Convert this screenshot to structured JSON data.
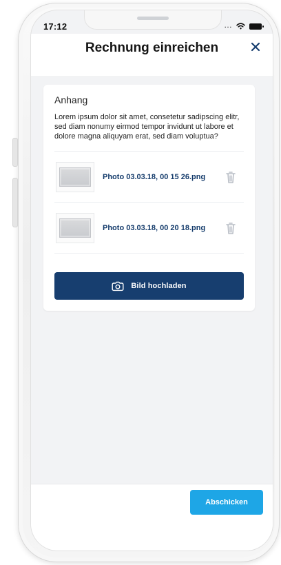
{
  "status_bar": {
    "time": "17:12",
    "signal_icon": "signal-dots-icon",
    "wifi_icon": "wifi-icon",
    "battery_icon": "battery-icon"
  },
  "header": {
    "title": "Rechnung einreichen",
    "close_icon": "close-icon"
  },
  "attachment_section": {
    "heading": "Anhang",
    "description": "Lorem ipsum dolor sit amet, consetetur sadipscing elitr, sed diam nonumy eirmod tempor invidunt ut labore et dolore magna aliquyam erat, sed diam voluptua?",
    "items": [
      {
        "file_name": "Photo 03.03.18, 00 15 26.png",
        "delete_icon": "trash-icon"
      },
      {
        "file_name": "Photo 03.03.18, 00 20 18.png",
        "delete_icon": "trash-icon"
      }
    ],
    "upload_button": {
      "label": "Bild hochladen",
      "icon": "camera-icon"
    }
  },
  "footer": {
    "submit_button": {
      "label": "Abschicken"
    }
  },
  "colors": {
    "primary_navy": "#173E6F",
    "link_blue": "#143B6B",
    "accent_blue": "#1EA6E6",
    "background": "#F2F3F5",
    "card": "#FFFFFF"
  }
}
